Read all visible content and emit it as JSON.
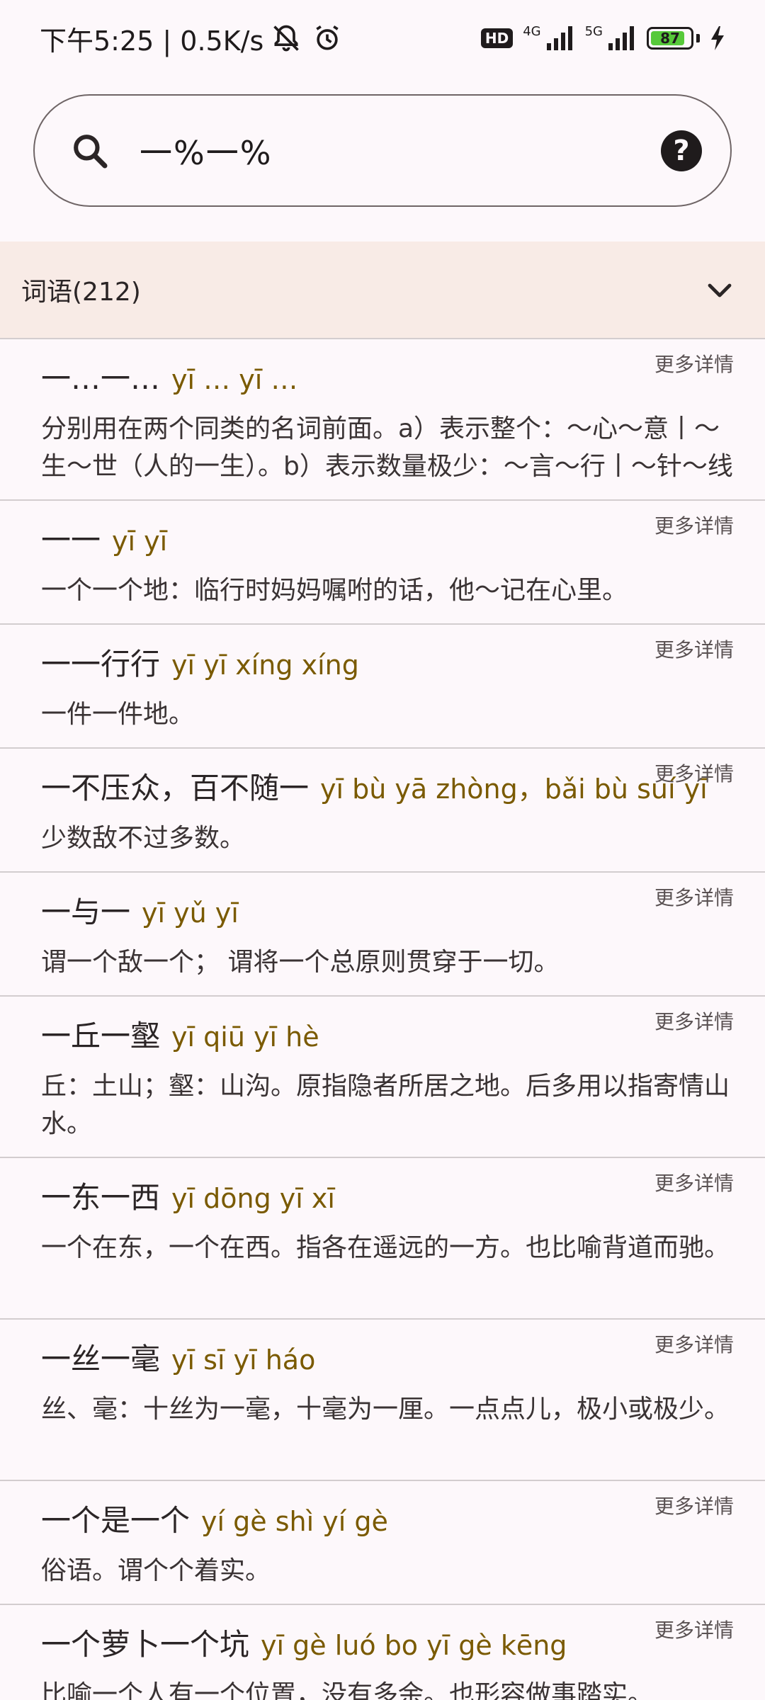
{
  "status_bar": {
    "time_speed": "下午5:25 | 0.5K/s",
    "hd": "HD",
    "net1": "4G",
    "net2": "5G",
    "battery": "87",
    "battery_level_percent": 87
  },
  "search": {
    "query": "一%一%"
  },
  "section": {
    "title": "词语(212)"
  },
  "entries": [
    {
      "word": "一…一…",
      "pinyin": "yī … yī …",
      "more": "更多详情",
      "definition": "分别用在两个同类的名词前面。a）表示整个：～心～意丨～生～世（人的一生）。b）表示数量极少：～言～行丨～针～线",
      "lines": 2
    },
    {
      "word": "一一",
      "pinyin": "yī yī",
      "more": "更多详情",
      "definition": "一个一个地：临行时妈妈嘱咐的话，他～记在心里。",
      "lines": 1
    },
    {
      "word": "一一行行",
      "pinyin": "yī yī xíng xíng",
      "more": "更多详情",
      "definition": "一件一件地。",
      "lines": 1
    },
    {
      "word": "一不压众，百不随一",
      "pinyin": "yī bù yā zhòng，bǎi bù suí yī",
      "more": "更多详情",
      "definition": "少数敌不过多数。",
      "lines": 1
    },
    {
      "word": "一与一",
      "pinyin": "yī yǔ yī",
      "more": "更多详情",
      "definition": "谓一个敌一个； 谓将一个总原则贯穿于一切。",
      "lines": 1
    },
    {
      "word": "一丘一壑",
      "pinyin": "yī qiū yī hè",
      "more": "更多详情",
      "definition": "丘：土山；壑：山沟。原指隐者所居之地。后多用以指寄情山水。",
      "lines": 2
    },
    {
      "word": "一东一西",
      "pinyin": "yī dōng yī xī",
      "more": "更多详情",
      "definition": "一个在东，一个在西。指各在遥远的一方。也比喻背道而驰。",
      "lines": 2
    },
    {
      "word": "一丝一毫",
      "pinyin": "yī sī yī háo",
      "more": "更多详情",
      "definition": "丝、毫：十丝为一毫，十毫为一厘。一点点儿，极小或极少。",
      "lines": 2
    },
    {
      "word": "一个是一个",
      "pinyin": "yí gè shì yí gè",
      "more": "更多详情",
      "definition": "俗语。谓个个着实。",
      "lines": 1
    },
    {
      "word": "一个萝卜一个坑",
      "pinyin": "yī gè luó bo yī gè kēng",
      "more": "更多详情",
      "definition": "比喻一个人有一个位置，没有多余。也形容做事踏实。",
      "lines": 1
    }
  ]
}
